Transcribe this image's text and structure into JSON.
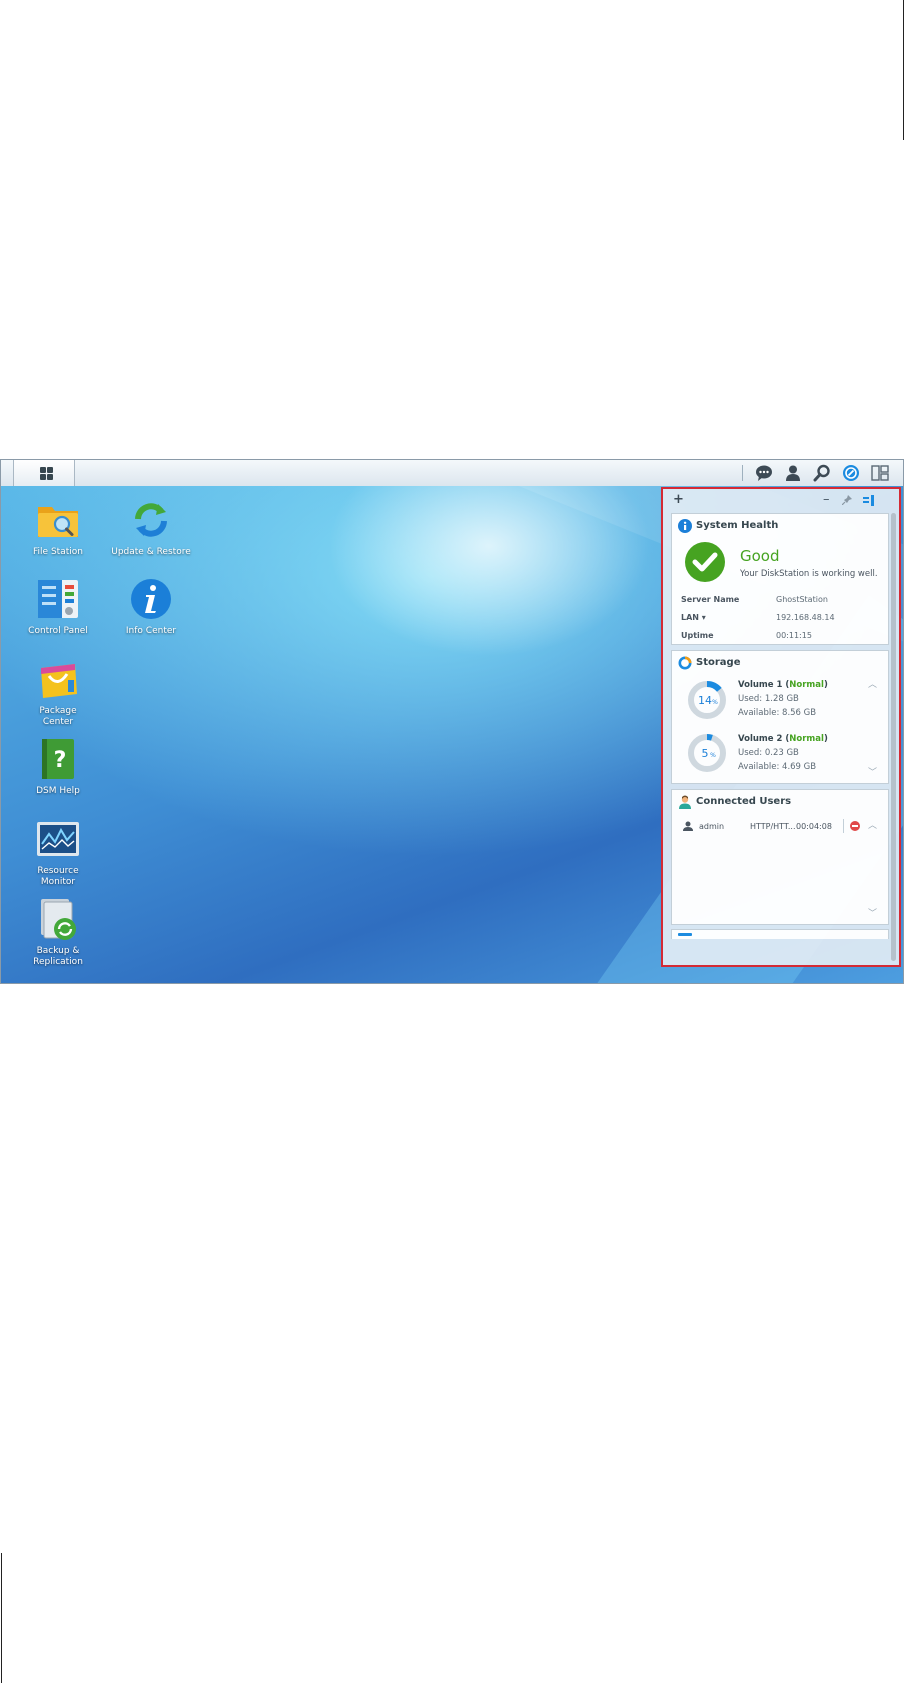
{
  "desktop_apps": [
    {
      "name": "File Station",
      "icon": "file-station-icon"
    },
    {
      "name": "Update & Restore",
      "icon": "update-restore-icon"
    },
    {
      "name": "Control Panel",
      "icon": "control-panel-icon"
    },
    {
      "name": "Info Center",
      "icon": "info-center-icon"
    },
    {
      "name_line1": "Package",
      "name_line2": "Center",
      "icon": "package-center-icon"
    },
    {
      "name": "DSM Help",
      "icon": "dsm-help-icon"
    },
    {
      "name_line1": "Resource",
      "name_line2": "Monitor",
      "icon": "resource-monitor-icon"
    },
    {
      "name": "Backup & Replication",
      "icon": "backup-replication-icon"
    }
  ],
  "taskbar": {
    "icons": [
      "main-menu-icon",
      "notifications-icon",
      "user-icon",
      "search-icon",
      "dsm-icon",
      "widgets-icon"
    ]
  },
  "widget_panel": {
    "add_label": "+",
    "minimize_label": "–",
    "system_health": {
      "title": "System Health",
      "status": "Good",
      "message": "Your DiskStation is working well.",
      "server_name_label": "Server Name",
      "server_name": "GhostStation",
      "lan_label": "LAN ▾",
      "lan_ip": "192.168.48.14",
      "uptime_label": "Uptime",
      "uptime": "00:11:15"
    },
    "storage": {
      "title": "Storage",
      "volumes": [
        {
          "name": "Volume 1",
          "status": "Normal",
          "percent_label": "14",
          "percent": 14,
          "used": "Used: 1.28 GB",
          "available": "Available: 8.56 GB"
        },
        {
          "name": "Volume 2",
          "status": "Normal",
          "percent_label": "5",
          "percent": 5,
          "used": "Used: 0.23 GB",
          "available": "Available: 4.69 GB"
        }
      ],
      "percent_sign": "%"
    },
    "connected_users": {
      "title": "Connected Users",
      "rows": [
        {
          "user": "admin",
          "type": "HTTP/HTT...",
          "time": "00:04:08"
        }
      ]
    }
  },
  "colors": {
    "accent_blue": "#1b8be0",
    "status_green": "#46a321",
    "highlight_red": "#d42a35"
  }
}
